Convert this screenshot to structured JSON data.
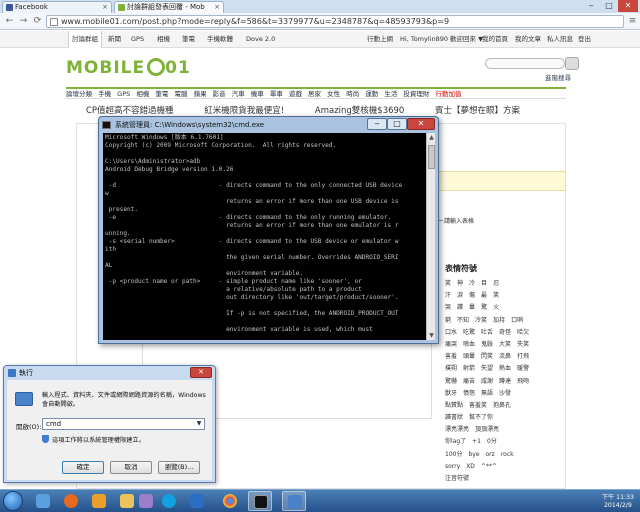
{
  "browser": {
    "tabs": [
      {
        "label": "Facebook",
        "close": "×"
      },
      {
        "label": "討論群組發表回覆 - Mob",
        "close": "×"
      }
    ],
    "url": "www.mobile01.com/post.php?mode=reply&f=586&t=3379977&u=2348787&q=48593793&p=9",
    "window_controls": {
      "minimize": "‒",
      "maximize": "□",
      "close": "✕"
    },
    "nav": {
      "back": "←",
      "forward": "→",
      "reload": "⟳",
      "menu": "≡"
    }
  },
  "site": {
    "top_nav": [
      "討論群組",
      "新聞",
      "GPS",
      "相機",
      "筆電",
      "手機軟體",
      "Dove 2.0"
    ],
    "user_nav": [
      "行動上網",
      "Hi, Tomylin890 歡迎回來 ▼",
      "我的首頁",
      "我的文章",
      "私人訊息",
      "登出"
    ],
    "logo": "MOBILE",
    "logo_suffix": "01",
    "advanced_search": "進階搜尋",
    "categories": [
      "論壇分類",
      "手機",
      "GPS",
      "相機",
      "筆電",
      "電腦",
      "蘋果",
      "影音",
      "汽車",
      "機車",
      "單車",
      "遊戲",
      "居家",
      "女性",
      "時尚",
      "運動",
      "生活",
      "投資理財",
      "行動加值"
    ],
    "promos": [
      "CP值超高不容錯過機種",
      "紅米機限貨我最便宜!",
      "Amazing雙核機$3690",
      "賓士【夢想在眼】方案"
    ],
    "sidebar_note": "ㄧ請輸入表格",
    "emoji_title": "表情符號",
    "emoji_rows": [
      [
        "笑",
        "神",
        "冷",
        "目",
        "忍"
      ],
      [
        "汗",
        "淚",
        "傷",
        "最",
        "笑"
      ],
      [
        "哭",
        "讚",
        "暈",
        "驚",
        "火"
      ],
      [
        "窮",
        "不知",
        "冷笑",
        "加持",
        "口哨"
      ],
      [
        "口水",
        "吃驚",
        "吐舌",
        "奇怪",
        "哈欠"
      ],
      [
        "痛哭",
        "噴血",
        "鬼臉",
        "大笑",
        "失笑"
      ],
      [
        "害羞",
        "頭暈",
        "閃笑",
        "流鼻",
        "打飛"
      ],
      [
        "撲朔",
        "射箭",
        "失望",
        "熱血",
        "暖警"
      ],
      [
        "驚嚇",
        "痛苦",
        "咸謝",
        "蹲達",
        "飛吻"
      ],
      [
        "獸牙",
        "憤怒",
        "無語",
        "沙發"
      ],
      [
        "點贊點",
        "害羞笑",
        "抱鼻孔"
      ],
      [
        "讀書狀",
        "幫不了你"
      ],
      [
        "漂亮漂亮",
        "頂頂漂亮"
      ],
      [
        "你lag了",
        "+1",
        "0分"
      ],
      [
        "100分",
        "bye",
        "orz",
        "rock"
      ],
      [
        "sorry",
        "XD",
        "^**^"
      ],
      [
        "注音符號"
      ]
    ]
  },
  "cmd": {
    "title": "系統管理員: C:\\Windows\\system32\\cmd.exe",
    "lines": [
      "Microsoft Windows [版本 6.1.7601]",
      "Copyright (c) 2009 Microsoft Corporation.  All rights reserved.",
      "",
      "C:\\Users\\Administrator>adb",
      "Android Debug Bridge version 1.0.26",
      "",
      " -d                            - directs command to the only connected USB device",
      "w",
      "                                 returns an error if more than one USB device is",
      " present.",
      " -e                            - directs command to the only running emulator.",
      "                                 returns an error if more than one emulator is r",
      "unning.",
      " -s <serial number>            - directs command to the USB device or emulator w",
      "ith",
      "                                 the given serial number. Overrides ANDROID_SERI",
      "AL",
      "                                 environment variable.",
      " -p <product name or path>     - simple product name like 'sooner', or",
      "                                 a relative/absolute path to a product",
      "                                 out directory like 'out/target/product/sooner'.",
      "",
      "                                 If -p is not specified, the ANDROID_PRODUCT_OUT",
      "",
      "                                 environment variable is used, which must"
    ]
  },
  "run_dialog": {
    "title": "執行",
    "close": "✕",
    "description": "輸入程式、資料夾、文件或網際網路資源的名稱，Windows 會自動開啟。",
    "open_label": "開啟(O):",
    "input_value": "cmd",
    "admin_note": "這項工作將以系統管理權限建立。",
    "ok": "確定",
    "cancel": "取消",
    "browse": "瀏覽(B)..."
  },
  "taskbar": {
    "time": "下午 11:33",
    "date": "2014/2/9",
    "items": [
      "explorer",
      "firefox",
      "media",
      "folder",
      "paint",
      "skype",
      "chat",
      "chrome",
      "cmd",
      "run"
    ]
  }
}
